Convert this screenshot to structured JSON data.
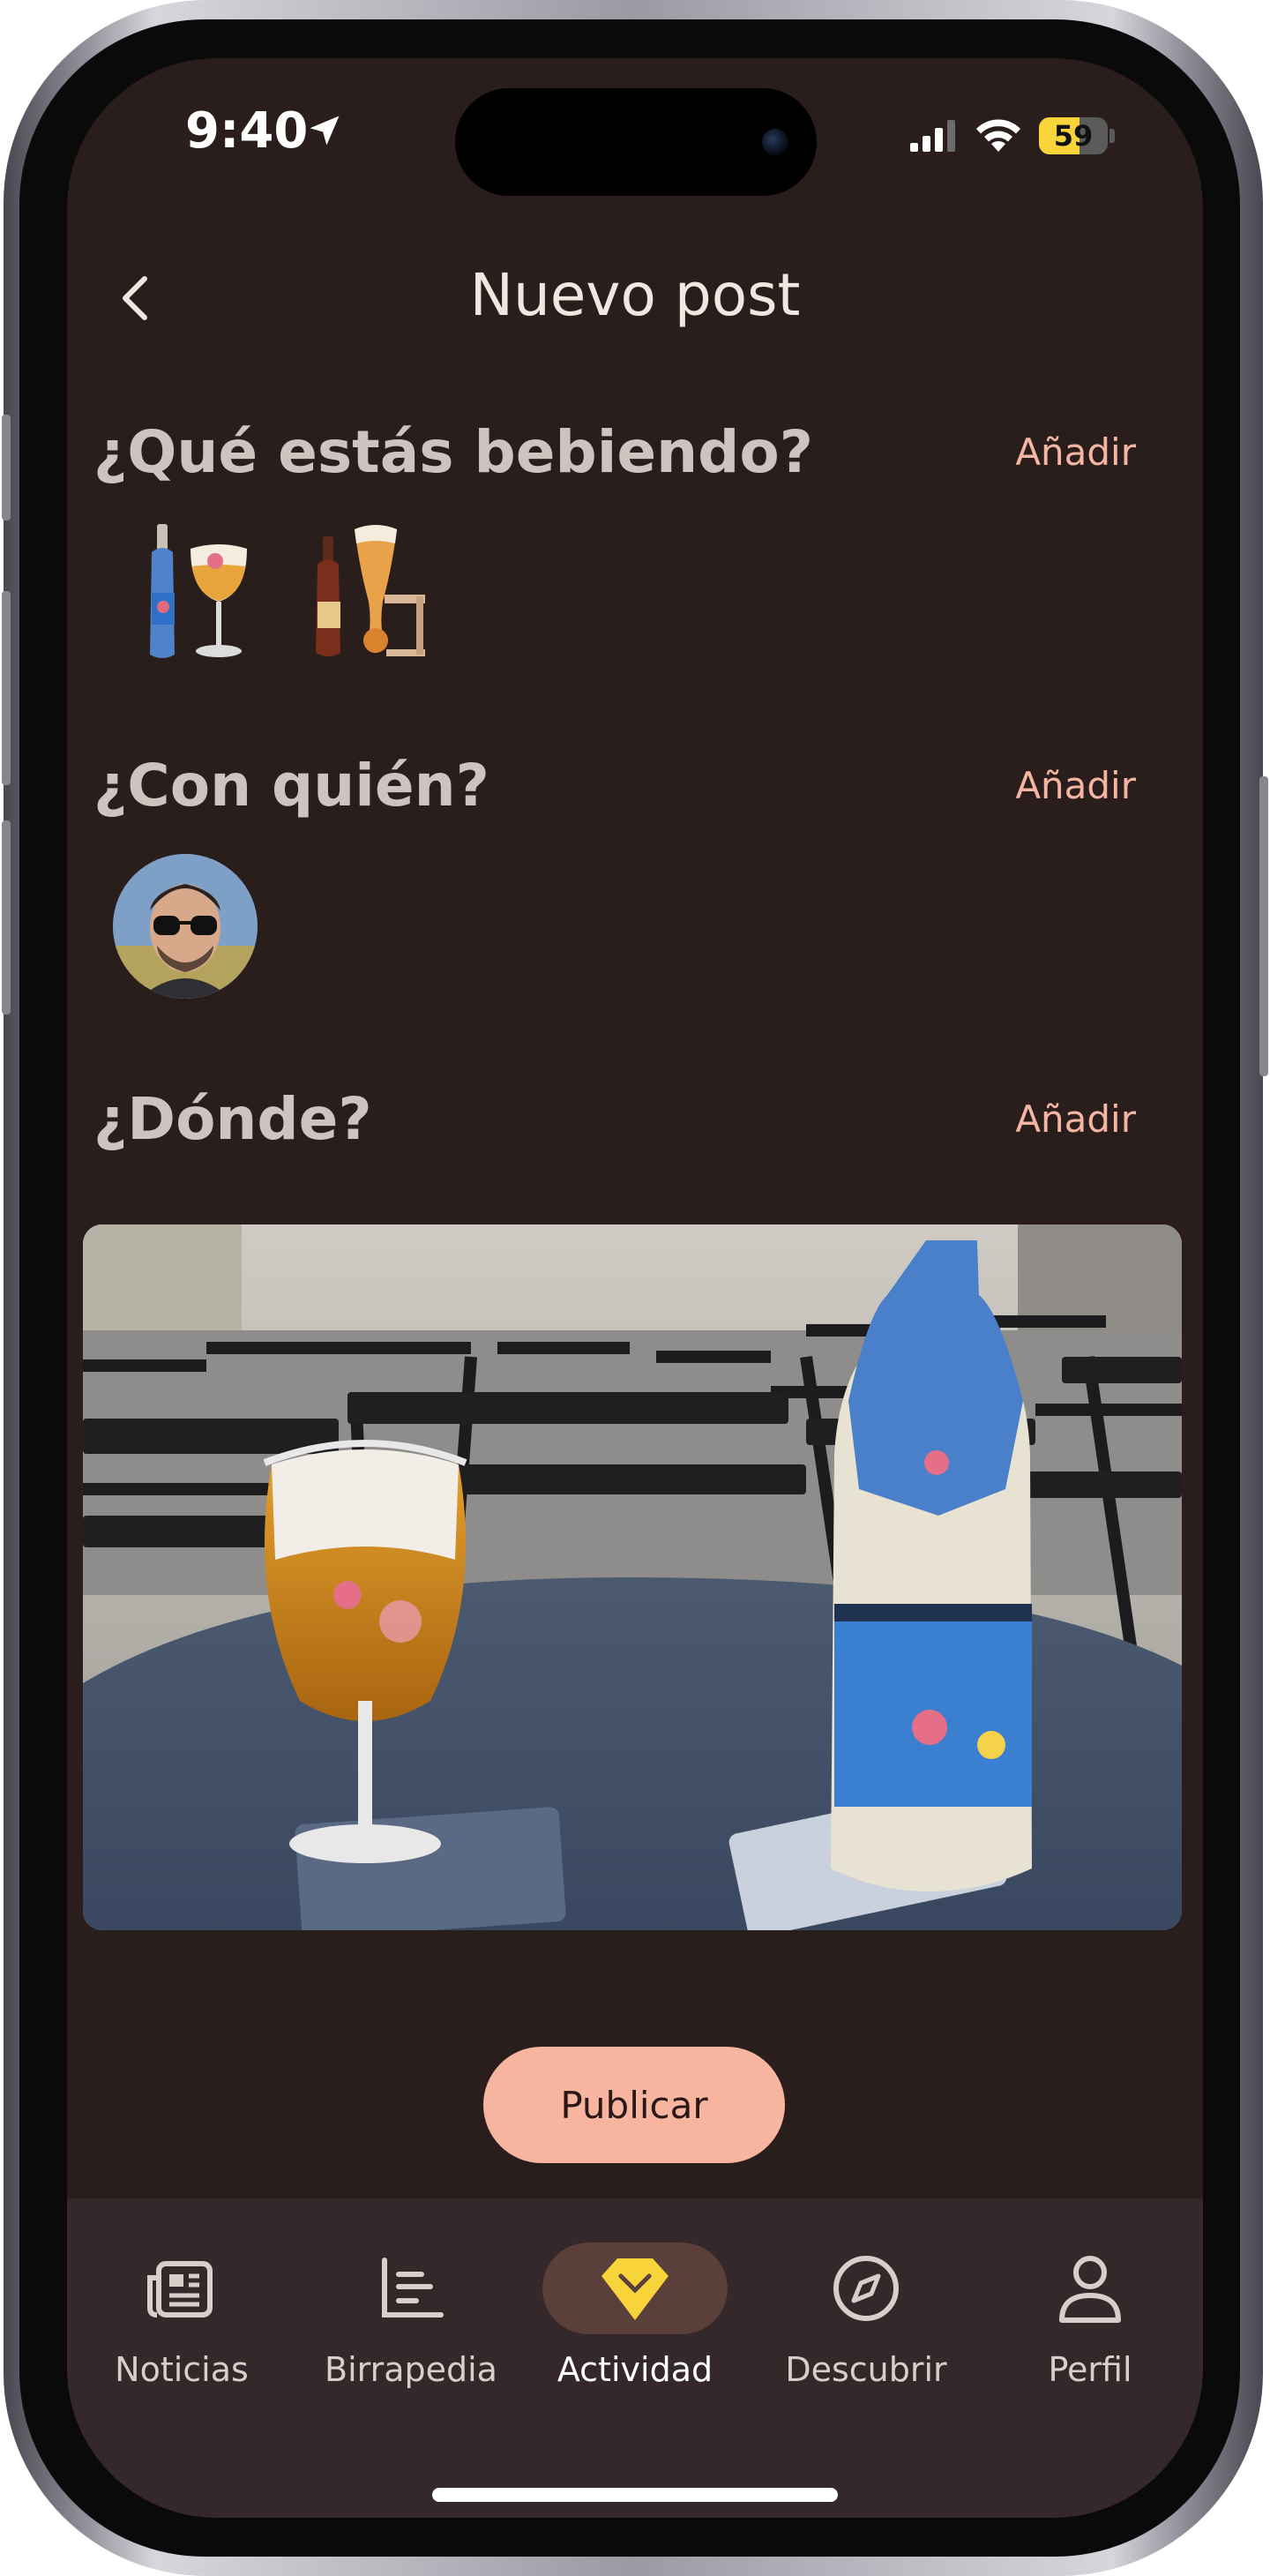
{
  "status_bar": {
    "time": "9:40",
    "battery": "59",
    "battery_level": 0.59
  },
  "header": {
    "title": "Nuevo post",
    "back_icon": "chevron-left-icon"
  },
  "sections": {
    "drinking": {
      "title": "¿Qué estás bebiendo?",
      "add_label": "Añadir"
    },
    "with_whom": {
      "title": "¿Con quién?",
      "add_label": "Añadir"
    },
    "where": {
      "title": "¿Dónde?",
      "add_label": "Añadir"
    }
  },
  "publish_label": "Publicar",
  "nav": {
    "items": [
      {
        "label": "Noticias",
        "icon": "newspaper-icon"
      },
      {
        "label": "Birrapedia",
        "icon": "list-icon"
      },
      {
        "label": "Actividad",
        "icon": "diamond-icon",
        "active": true
      },
      {
        "label": "Descubrir",
        "icon": "compass-icon"
      },
      {
        "label": "Perfil",
        "icon": "person-icon"
      }
    ]
  },
  "colors": {
    "background": "#2a1e1c",
    "accent": "#f4b5a2",
    "publish_button": "#f7b5a0",
    "nav_background": "#34282a",
    "active_icon": "#f8d43a"
  }
}
